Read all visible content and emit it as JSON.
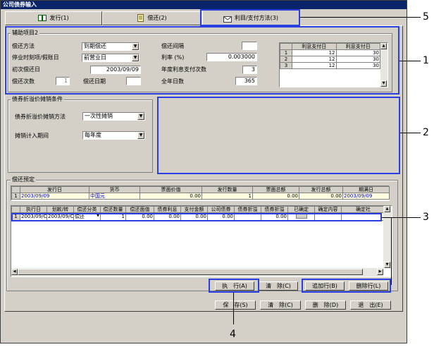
{
  "window": {
    "title": "公司债券输入"
  },
  "tabs": [
    {
      "label": "发行(1)",
      "icon": "book-icon"
    },
    {
      "label": "偿还(2)",
      "icon": "notepad-icon"
    },
    {
      "label": "利目/支付方法(3)",
      "icon": "envelope-icon"
    }
  ],
  "aux": {
    "title": "辅助项目2",
    "repay_method_label": "偿还方法",
    "repay_method_value": "到期偿还",
    "stop_day_label": "停业时刻项/假账日",
    "stop_day_value": "前营业日",
    "first_repay_label": "初次偿还日",
    "first_repay_value": "2003/09/09",
    "repay_count_label": "偿还次数",
    "repay_count_value": "1",
    "repay_date_label": "偿还日期",
    "repay_date_value": "",
    "interval_label": "偿还间隔",
    "interval_value": "",
    "rate_label": "利率 (%)",
    "rate_value": "0.003000",
    "annual_count_label": "年度利息支付次数",
    "annual_count_value": "3",
    "year_days_label": "全年日数",
    "year_days_value": "365",
    "interest_table": {
      "headers": [
        "利息支付日",
        "利息支付日"
      ],
      "rows": [
        {
          "n": "1",
          "a": "12",
          "b": "30"
        },
        {
          "n": "2",
          "a": "12",
          "b": "30"
        },
        {
          "n": "3",
          "a": "12",
          "b": "30"
        }
      ]
    }
  },
  "amort": {
    "title": "债券折溢价摊销条件",
    "method_label": "债券折溢价摊销方法",
    "method_value": "一次性摊销",
    "period_label": "摊销计入期间",
    "period_value": "每年度"
  },
  "repay": {
    "title": "偿还预定",
    "top_headers": [
      "发行日",
      "货币",
      "票面价值",
      "发行数量",
      "票面总额",
      "发行总额",
      "期满日"
    ],
    "top_row": [
      "1",
      "2003/09/09",
      "中国元",
      "0.00",
      "1",
      "0.00",
      "0.00",
      "2003/09/09"
    ],
    "grid_headers": [
      "执行日",
      "划款/转",
      "偿还分类",
      "偿还数量",
      "偿还面值",
      "债券利息",
      "支付金额",
      "公司债券",
      "债券折溢",
      "债券折溢",
      "已确定",
      "确定内容",
      "确定社"
    ],
    "grid_row": [
      "1",
      "2003/09/C",
      "2003/09/C",
      "偿还",
      "1",
      "0.00",
      "0.00",
      "0.00",
      "0.00",
      "",
      "0.00",
      "",
      "",
      ""
    ]
  },
  "buttons": {
    "execute": "执　行(A)",
    "clear_inner": "清　除(C)",
    "add_row": "追加行(B)",
    "delete_row": "删除行(L)",
    "save": "保　存(S)",
    "clear": "清　除(C)",
    "delete": "删　除(D)",
    "exit": "退　出(E)"
  },
  "callouts": [
    "1",
    "2",
    "3",
    "4",
    "5"
  ],
  "colors": {
    "highlight": "#2a3fe0",
    "title_bar": "#0a246a",
    "link_blue": "#0000cc"
  }
}
